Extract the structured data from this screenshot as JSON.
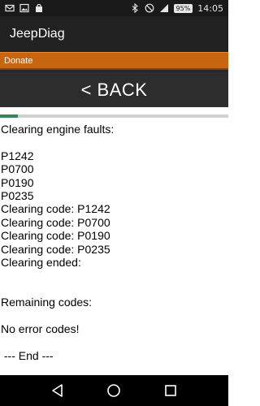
{
  "status_bar": {
    "battery_label": "95%",
    "time": "14:05",
    "icons": [
      "mail-icon",
      "image-icon",
      "bag-icon",
      "bluetooth-icon",
      "do-not-disturb-icon",
      "signal-icon"
    ]
  },
  "app_bar": {
    "title": "JeepDiag"
  },
  "donate": {
    "label": "Donate"
  },
  "back_button": {
    "label": "< BACK"
  },
  "progress": {
    "fraction": 0.08,
    "color": "#2e8b57"
  },
  "log_lines": [
    "Clearing engine faults:",
    "",
    "P1242",
    "P0700",
    "P0190",
    "P0235",
    "Clearing code: P1242",
    "Clearing code: P0700",
    "Clearing code: P0190",
    "Clearing code: P0235",
    "Clearing ended:",
    "",
    "",
    "Remaining codes:",
    "",
    "No error codes!",
    "",
    " --- End ---"
  ],
  "colors": {
    "donate_bg": "#c86510",
    "app_bar_bg": "#222222",
    "back_bg": "#2d2d2d"
  }
}
